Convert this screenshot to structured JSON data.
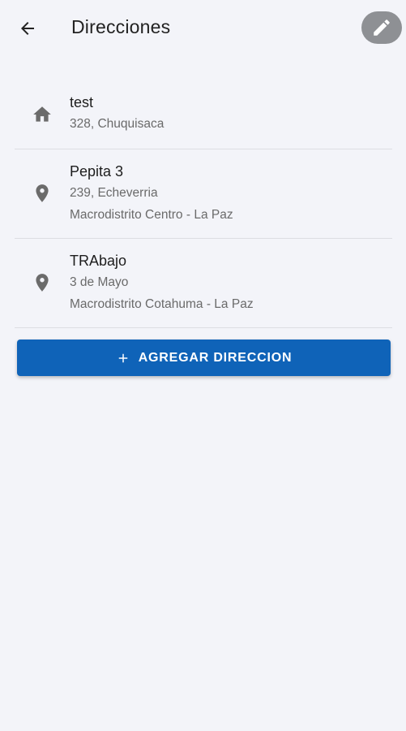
{
  "header": {
    "title": "Direcciones",
    "back_icon": "arrow-left-icon",
    "edit_icon": "pencil-icon"
  },
  "addresses": [
    {
      "icon": "home-icon",
      "name": "test",
      "line1": "328, Chuquisaca",
      "line2": ""
    },
    {
      "icon": "location-pin-icon",
      "name": "Pepita 3",
      "line1": "239, Echeverria",
      "line2": "Macrodistrito Centro - La Paz"
    },
    {
      "icon": "location-pin-icon",
      "name": "TRAbajo",
      "line1": "3 de Mayo",
      "line2": "Macrodistrito Cotahuma - La Paz"
    }
  ],
  "add_button": {
    "label": "AGREGAR DIRECCION",
    "icon": "plus-icon"
  },
  "colors": {
    "background": "#f3f4f9",
    "primary": "#0f63b8",
    "icon_gray": "#6b6b6b",
    "edit_button": "#8e9094"
  }
}
